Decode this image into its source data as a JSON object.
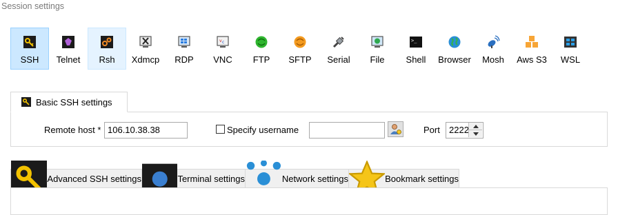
{
  "window": {
    "title": "Session settings"
  },
  "session_types": [
    {
      "label": "SSH",
      "icon": "ssh-key-icon"
    },
    {
      "label": "Telnet",
      "icon": "telnet-icon"
    },
    {
      "label": "Rsh",
      "icon": "rsh-icon"
    },
    {
      "label": "Xdmcp",
      "icon": "xdmcp-icon"
    },
    {
      "label": "RDP",
      "icon": "rdp-icon"
    },
    {
      "label": "VNC",
      "icon": "vnc-icon"
    },
    {
      "label": "FTP",
      "icon": "ftp-icon"
    },
    {
      "label": "SFTP",
      "icon": "sftp-icon"
    },
    {
      "label": "Serial",
      "icon": "serial-icon"
    },
    {
      "label": "File",
      "icon": "file-icon"
    },
    {
      "label": "Shell",
      "icon": "shell-icon"
    },
    {
      "label": "Browser",
      "icon": "browser-icon"
    },
    {
      "label": "Mosh",
      "icon": "mosh-icon"
    },
    {
      "label": "Aws S3",
      "icon": "aws-s3-icon"
    },
    {
      "label": "WSL",
      "icon": "wsl-icon"
    }
  ],
  "basic_tab": {
    "label": "Basic SSH settings",
    "remote_host_label": "Remote host *",
    "remote_host_value": "106.10.38.38",
    "specify_username_label": "Specify username",
    "specify_username_checked": false,
    "username_value": "",
    "port_label": "Port",
    "port_value": "2222"
  },
  "bottom_tabs": [
    {
      "label": "Advanced SSH settings",
      "icon": "wrench-icon"
    },
    {
      "label": "Terminal settings",
      "icon": "terminal-icon"
    },
    {
      "label": "Network settings",
      "icon": "network-icon"
    },
    {
      "label": "Bookmark settings",
      "icon": "star-icon"
    }
  ]
}
